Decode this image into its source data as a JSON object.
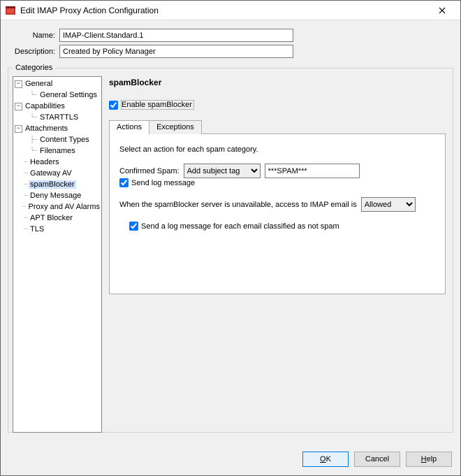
{
  "window": {
    "title": "Edit IMAP Proxy Action Configuration"
  },
  "form": {
    "name_label": "Name:",
    "name_value": "IMAP-Client.Standard.1",
    "desc_label": "Description:",
    "desc_value": "Created by Policy Manager"
  },
  "categories": {
    "legend": "Categories",
    "nodes": {
      "general": "General",
      "general_settings": "General Settings",
      "capabilities": "Capabilities",
      "starttls": "STARTTLS",
      "attachments": "Attachments",
      "content_types": "Content Types",
      "filenames": "Filenames",
      "headers": "Headers",
      "gateway_av": "Gateway AV",
      "spamblocker": "spamBlocker",
      "deny_message": "Deny Message",
      "proxy_av_alarms": "Proxy and AV Alarms",
      "apt_blocker": "APT Blocker",
      "tls": "TLS"
    }
  },
  "panel": {
    "title": "spamBlocker",
    "enable_label": "Enable spamBlocker",
    "tabs": {
      "actions": "Actions",
      "exceptions": "Exceptions"
    },
    "select_note": "Select an action for each spam category.",
    "confirmed_label": "Confirmed Spam:",
    "confirmed_action": "Add subject tag",
    "confirmed_tag": "***SPAM***",
    "send_log_label": "Send log message",
    "unavailable_prefix": "When the spamBlocker server is unavailable, access to IMAP email is",
    "unavailable_action": "Allowed",
    "not_spam_log_label": "Send a log message for each email classified as not spam"
  },
  "buttons": {
    "ok": "OK",
    "cancel": "Cancel",
    "help": "Help"
  }
}
